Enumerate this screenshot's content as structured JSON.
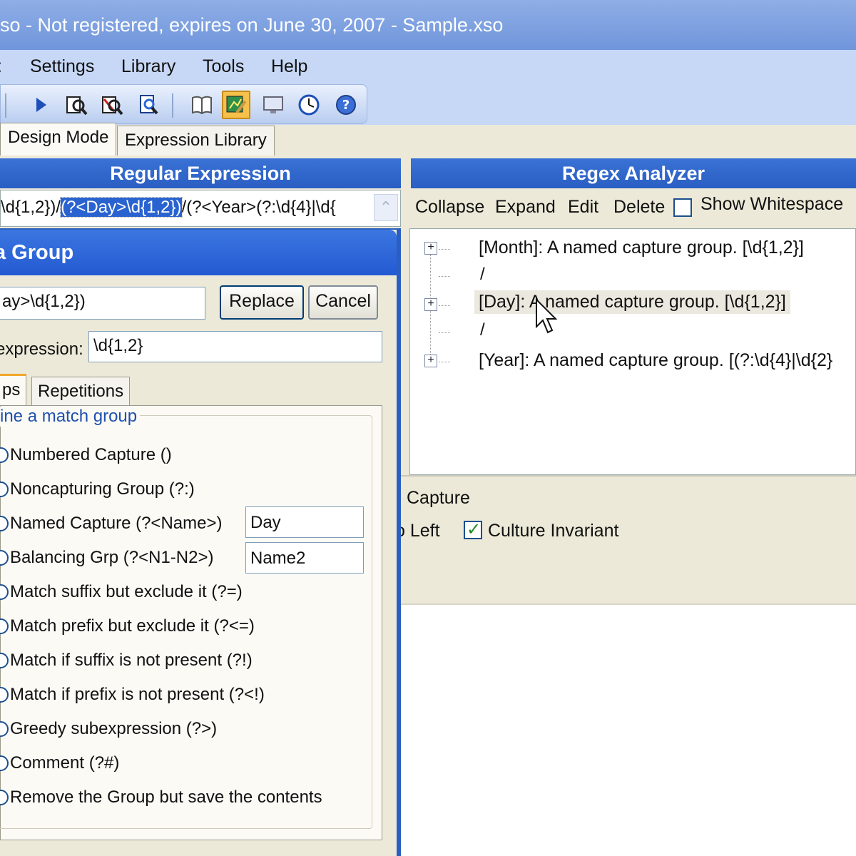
{
  "window": {
    "title": "so - Not registered, expires on June 30, 2007 - Sample.xso"
  },
  "menu": {
    "items": [
      ":",
      "Settings",
      "Library",
      "Tools",
      "Help"
    ]
  },
  "toolbar": {
    "buttons": [
      "play-icon",
      "find-icon",
      "find-replace-icon",
      "document-search-icon",
      "book-icon",
      "design-mode-icon",
      "monitor-icon",
      "clock-icon",
      "help-icon"
    ],
    "active": "design-mode-icon"
  },
  "main_tabs": {
    "design": "Design Mode",
    "library": "Expression Library"
  },
  "regex_panel": {
    "header": "Regular Expression",
    "expr_before": "\\d{1,2})/",
    "expr_highlight": "(?<Day>\\d{1,2})",
    "expr_after": "/(?<Year>(?:\\d{4}|\\d{"
  },
  "analyzer": {
    "header": "Regex Analyzer",
    "actions": {
      "collapse": "Collapse",
      "expand": "Expand",
      "edit": "Edit",
      "delete": "Delete",
      "show_whitespace": "Show Whitespace"
    },
    "show_whitespace_checked": false,
    "nodes": [
      "[Month]: A named capture group. [\\d{1,2}]",
      "/",
      "[Day]: A named capture group. [\\d{1,2}]",
      "/",
      "[Year]: A named capture group. [(?:\\d{4}|\\d{2}"
    ]
  },
  "options": {
    "capture": "Capture",
    "right_to_left": "o Left",
    "culture_invariant": "Culture Invariant",
    "culture_invariant_checked": true
  },
  "dialog": {
    "title": "a Group",
    "group_value": "ay>\\d{1,2})",
    "replace": "Replace",
    "cancel": "Cancel",
    "expression_label": "expression:",
    "expression_value": "\\d{1,2}",
    "tabs": {
      "groups": "ps",
      "repetitions": "Repetitions"
    },
    "group_legend": "ine a match group",
    "radios": [
      "Numbered Capture ()",
      "Noncapturing Group (?:)",
      "Named Capture (?<Name>)",
      "Balancing Grp (?<N1-N2>)",
      "Match suffix but exclude it (?=)",
      "Match prefix but exclude it (?<=)",
      "Match if suffix is not present (?!)",
      "Match if prefix is not present (?<!)",
      "Greedy subexpression (?>)",
      "Comment (?#)",
      "Remove the Group but save the contents"
    ],
    "name_value": "Day",
    "name2_value": "Name2"
  }
}
